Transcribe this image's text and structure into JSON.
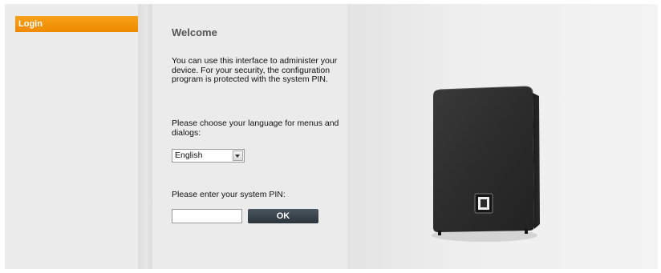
{
  "sidebar": {
    "items": [
      {
        "label": "Login",
        "active": true,
        "color": "#ef8a00"
      }
    ]
  },
  "main": {
    "title": "Welcome",
    "intro": "You can use this interface to administer your device. For your security, the configuration program is protected with the system PIN.",
    "language_prompt": "Please choose your language for menus and dialogs:",
    "language_select": {
      "selected": "English"
    },
    "pin_prompt": "Please enter your system PIN:",
    "pin_input": {
      "value": ""
    },
    "ok_label": "OK"
  },
  "hero": {
    "image": "base-station-device"
  }
}
